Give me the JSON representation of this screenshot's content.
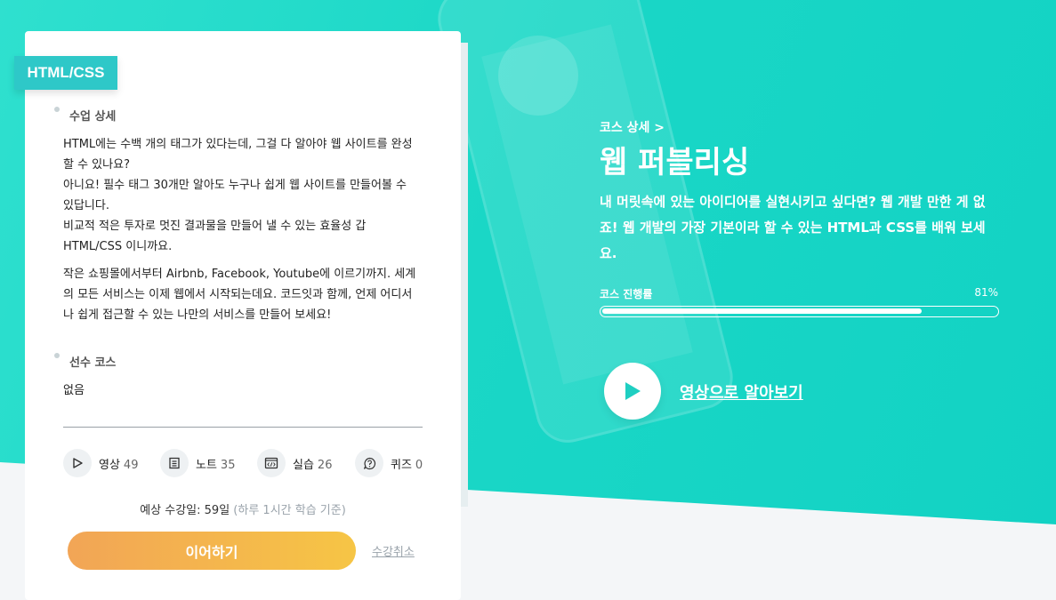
{
  "course": {
    "tag": "HTML/CSS",
    "breadcrumb": "코스 상세 >",
    "title": "웹 퍼블리싱",
    "subtitle": "내 머릿속에 있는 아이디어를 실현시키고 싶다면? 웹 개발 만한 게 없죠! 웹 개발의 가장 기본이라 할 수 있는 HTML과 CSS를 배워 보세요."
  },
  "progress": {
    "label": "코스 진행률",
    "percent_text": "81%",
    "value": 0.81
  },
  "video": {
    "link_label": "영상으로 알아보기"
  },
  "details": {
    "section_label": "수업 상세",
    "paragraph1": "HTML에는 수백 개의 태그가 있다는데, 그걸 다 알아야 웹 사이트를 완성\n할 수 있나요?\n아니요! 필수 태그 30개만 알아도 누구나 쉽게 웹 사이트를 만들어볼 수\n있답니다.\n비교적 적은 투자로 멋진 결과물을 만들어 낼 수 있는 효율성 갑\nHTML/CSS 이니까요.",
    "paragraph2": "작은 쇼핑몰에서부터 Airbnb, Facebook, Youtube에 이르기까지. 세계\n의 모든 서비스는 이제 웹에서 시작되는데요. 코드잇과 함께, 언제 어디서\n나 쉽게 접근할 수 있는 나만의 서비스를 만들어 보세요!"
  },
  "prereq": {
    "section_label": "선수 코스",
    "value": "없음"
  },
  "stats": [
    {
      "label": "영상",
      "count": "49",
      "icon": "play-icon"
    },
    {
      "label": "노트",
      "count": "35",
      "icon": "note-icon"
    },
    {
      "label": "실습",
      "count": "26",
      "icon": "code-icon"
    },
    {
      "label": "퀴즈",
      "count": "0",
      "icon": "question-icon"
    }
  ],
  "estimate": {
    "label": "예상 수강일: 59일",
    "note": "(하루 1시간 학습 기준)"
  },
  "actions": {
    "continue_label": "이어하기",
    "cancel_label": "수강취소"
  },
  "colors": {
    "accent": "#1ad7c6",
    "tag": "#2ec8c8",
    "button_start": "#f2a556",
    "button_end": "#f6c545"
  }
}
